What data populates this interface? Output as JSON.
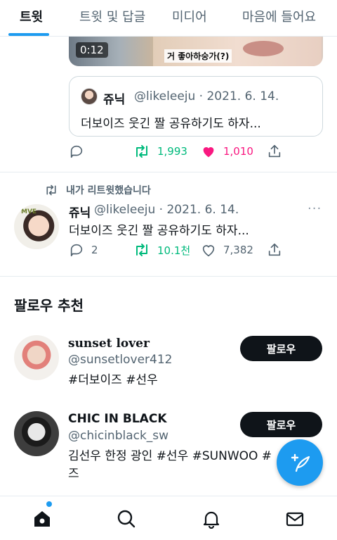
{
  "tabs": [
    {
      "label": "트윗",
      "active": true
    },
    {
      "label": "트윗 및 답글",
      "active": false
    },
    {
      "label": "미디어",
      "active": false
    },
    {
      "label": "마음에 들어요",
      "active": false
    }
  ],
  "video": {
    "time": "0:12",
    "caption": "거 좋아하숭가(?)"
  },
  "quote": {
    "name": "쥬닉",
    "handle_date": "@likeleeju · 2021. 6. 14.",
    "text": "더보이즈 웃긴 짤 공유하기도 하자..."
  },
  "tweet1_actions": {
    "reply_count": "",
    "retweet_count": "1,993",
    "like_count": "1,010"
  },
  "retweet_label": "내가 리트윗했습니다",
  "tweet2": {
    "avatar_tag": "MVE",
    "name": "쥬닉",
    "handle_date": "@likeleeju · 2021. 6. 14.",
    "text": "더보이즈 웃긴 짤 공유하기도 하자...",
    "more": "···",
    "reply_count": "2",
    "retweet_count": "10.1천",
    "like_count": "7,382"
  },
  "suggestions": {
    "title": "팔로우 추천",
    "items": [
      {
        "name": "sunset lover",
        "handle": "@sunsetlover412",
        "bio": "#더보이즈 #선우",
        "button": "팔로우"
      },
      {
        "name": "CHIC IN BLACK",
        "handle": "@chicinblack_sw",
        "bio": "김선우 한정 광인 #선우 #SUNWOO #",
        "bio2": "즈",
        "button": "팔로우"
      }
    ]
  },
  "colors": {
    "accent": "#1d9bf0",
    "retweet": "#00ba7c",
    "like": "#f91880",
    "muted": "#536471"
  },
  "icons": {
    "fab": "compose-tweet-icon",
    "nav": [
      "home-icon",
      "search-icon",
      "bell-icon",
      "mail-icon"
    ]
  }
}
